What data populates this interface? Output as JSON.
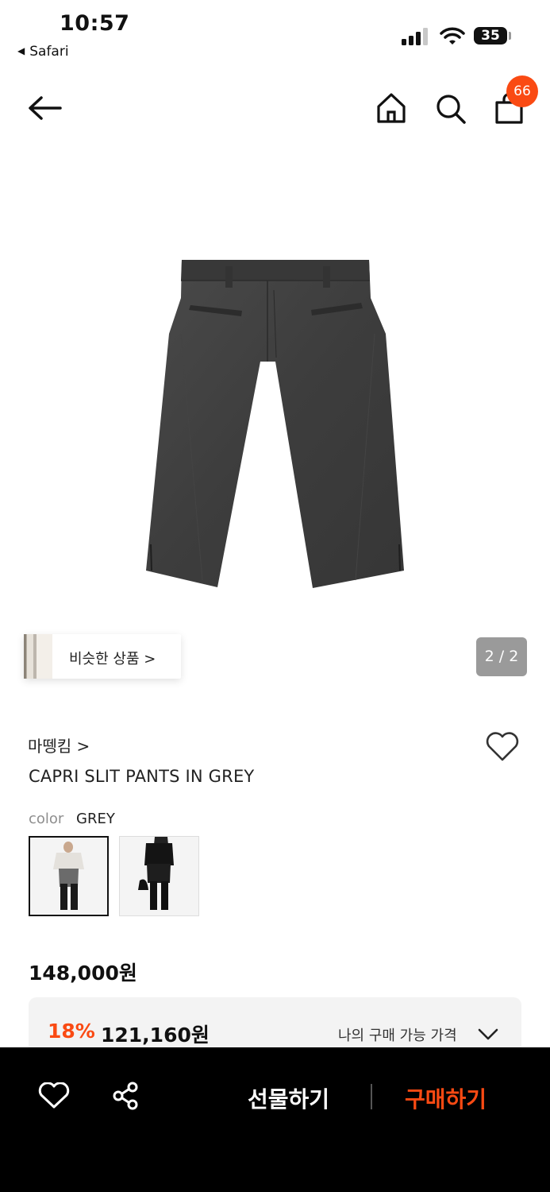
{
  "status_bar": {
    "time": "10:57",
    "back_app": "Safari",
    "battery": "35"
  },
  "header": {
    "cart_count": "66",
    "icons": [
      "back-arrow-icon",
      "home-icon",
      "search-icon",
      "shopping-bag-icon"
    ]
  },
  "gallery": {
    "similar_products_label": "비슷한 상품 >",
    "page_counter": "2 / 2",
    "product_image": "grey-capri-pants"
  },
  "product": {
    "brand": "마뗑킴 >",
    "name": "CAPRI SLIT PANTS IN GREY",
    "color_label": "color",
    "color_value": "GREY",
    "swatches": [
      "grey-outfit",
      "black-outfit"
    ],
    "price": "148,000원",
    "discount_rate": "18%",
    "discount_price": "121,160원",
    "my_price_label": "나의 구매 가능 가격"
  },
  "bottom_bar": {
    "gift_label": "선물하기",
    "buy_label": "구매하기"
  },
  "colors": {
    "accent": "#fa4a13",
    "bottom_bar_bg": "#000000",
    "counter_bg": "#9a9a9a"
  }
}
